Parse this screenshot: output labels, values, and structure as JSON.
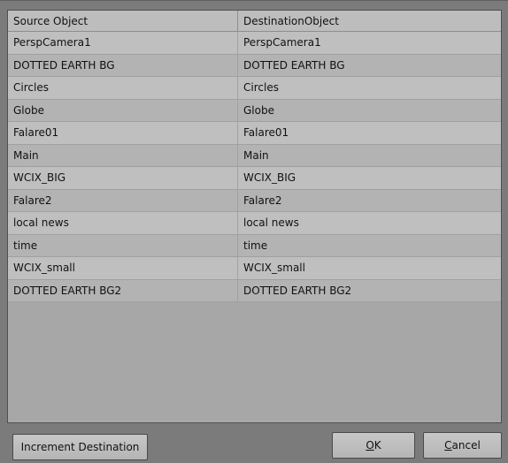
{
  "table": {
    "headers": [
      "Source Object",
      "DestinationObject"
    ],
    "rows": [
      [
        "PerspCamera1",
        "PerspCamera1"
      ],
      [
        "DOTTED EARTH BG",
        "DOTTED EARTH BG"
      ],
      [
        "Circles",
        "Circles"
      ],
      [
        "Globe",
        "Globe"
      ],
      [
        "Falare01",
        "Falare01"
      ],
      [
        "Main",
        "Main"
      ],
      [
        "WCIX_BIG",
        "WCIX_BIG"
      ],
      [
        "Falare2",
        "Falare2"
      ],
      [
        "local news",
        "local news"
      ],
      [
        "time",
        "time"
      ],
      [
        "WCIX_small",
        "WCIX_small"
      ],
      [
        "DOTTED EARTH BG2",
        "DOTTED EARTH BG2"
      ]
    ]
  },
  "buttons": {
    "increment_label": "Increment Destination",
    "ok_label": "OK",
    "ok_mnemonic": "O",
    "ok_rest": "K",
    "cancel_label": "Cancel",
    "cancel_mnemonic": "C",
    "cancel_rest": "ancel"
  }
}
